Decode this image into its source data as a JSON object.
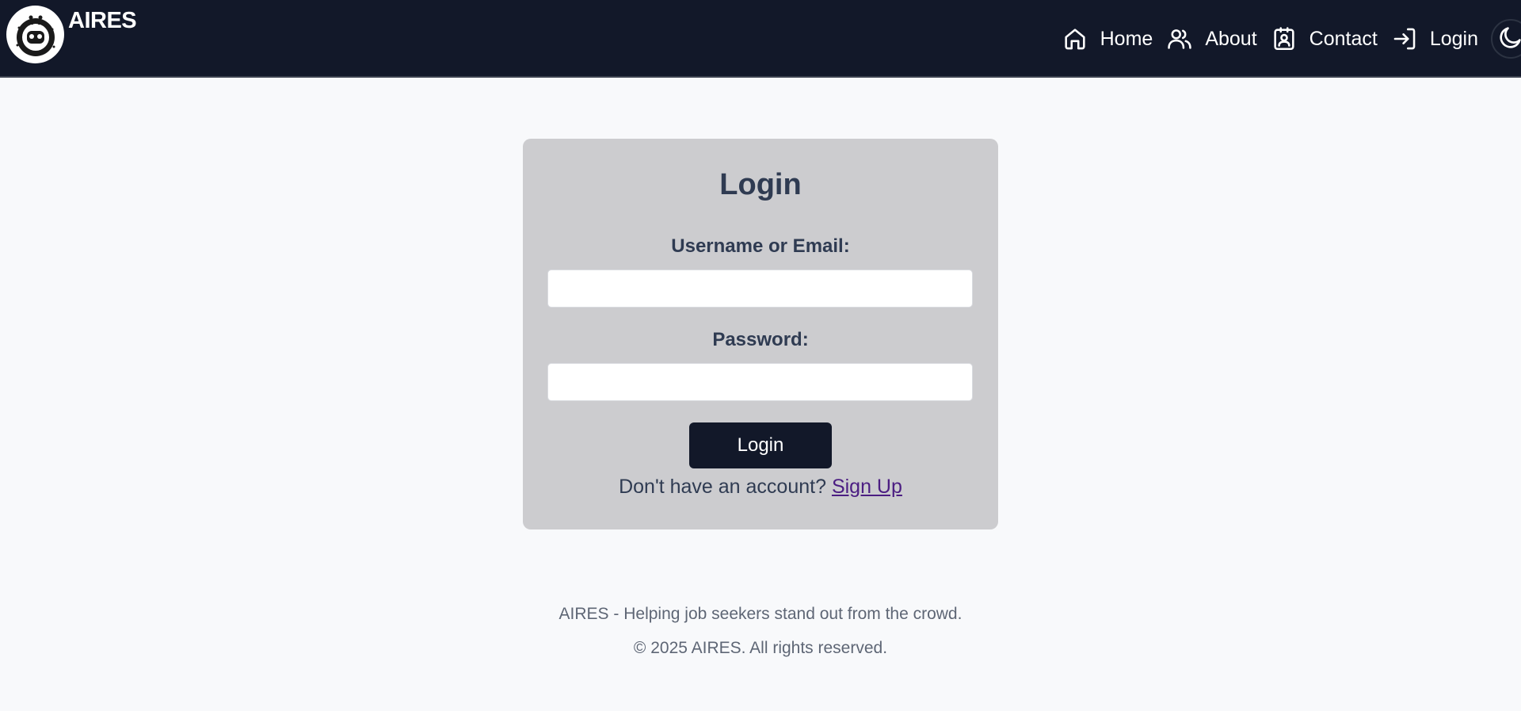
{
  "brand": {
    "name": "AIRES",
    "logo_icon": "robot-logo-icon"
  },
  "nav": {
    "items": [
      {
        "label": "Home",
        "icon": "home-icon"
      },
      {
        "label": "About",
        "icon": "users-icon"
      },
      {
        "label": "Contact",
        "icon": "contact-card-icon"
      },
      {
        "label": "Login",
        "icon": "sign-in-icon"
      }
    ],
    "theme_toggle_icon": "moon-icon"
  },
  "login_form": {
    "title": "Login",
    "username_label": "Username or Email:",
    "username_value": "",
    "password_label": "Password:",
    "password_value": "",
    "submit_label": "Login",
    "signup_prompt": "Don't have an account?",
    "signup_link": "Sign Up"
  },
  "footer": {
    "tagline": "AIRES - Helping job seekers stand out from the crowd.",
    "copyright": "© 2025 AIRES. All rights reserved."
  },
  "colors": {
    "navbar_bg": "#121829",
    "page_bg": "#f8f9fb",
    "card_bg": "#cccccf",
    "text_dark": "#2f3b52",
    "button_bg": "#121829",
    "link": "#4b1d82",
    "footer_text": "#5e6675"
  }
}
